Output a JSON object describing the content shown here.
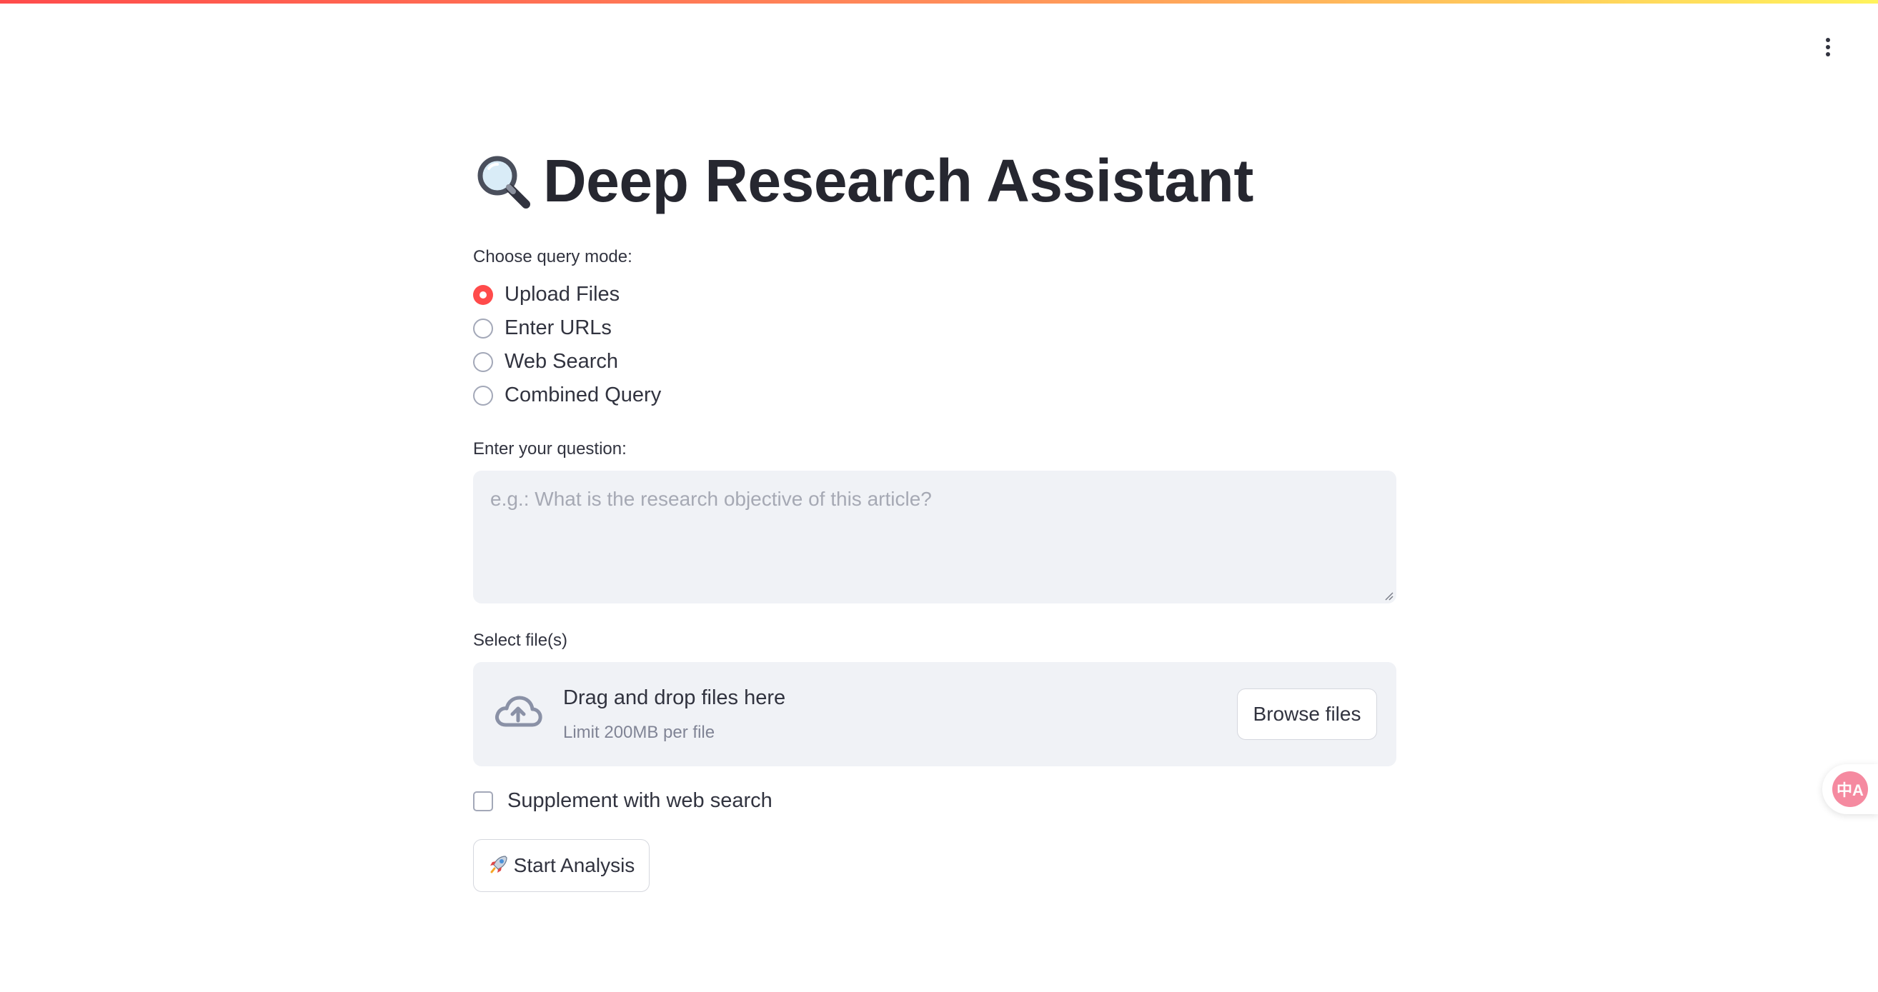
{
  "app": {
    "title": "Deep Research Assistant",
    "title_icon": "magnifying-glass-icon",
    "accent_color": "#ff4b4b"
  },
  "query_mode": {
    "label": "Choose query mode:",
    "options": [
      {
        "label": "Upload Files",
        "selected": true
      },
      {
        "label": "Enter URLs",
        "selected": false
      },
      {
        "label": "Web Search",
        "selected": false
      },
      {
        "label": "Combined Query",
        "selected": false
      }
    ]
  },
  "question": {
    "label": "Enter your question:",
    "placeholder": "e.g.: What is the research objective of this article?",
    "value": ""
  },
  "file_upload": {
    "label": "Select file(s)",
    "drop_title": "Drag and drop files here",
    "drop_subtitle": "Limit 200MB per file",
    "browse_label": "Browse files",
    "icon": "cloud-upload-icon"
  },
  "supplement": {
    "label": "Supplement with web search",
    "checked": false
  },
  "start_button": {
    "label": "Start Analysis",
    "icon": "rocket-icon"
  },
  "toolbar": {
    "menu_icon": "more-vertical-icon"
  },
  "translate_widget": {
    "icon": "translate-icon",
    "glyph": "中A"
  }
}
